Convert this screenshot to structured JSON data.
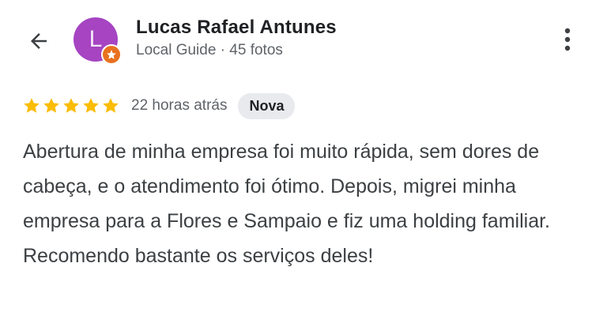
{
  "header": {
    "back_icon": "arrow-back-icon",
    "more_icon": "more-vert-icon"
  },
  "author": {
    "avatar_letter": "L",
    "avatar_color": "#a644c2",
    "badge_color": "#e8711f",
    "name": "Lucas Rafael Antunes",
    "meta": "Local Guide · 45 fotos"
  },
  "review": {
    "rating": 5,
    "max_rating": 5,
    "star_color": "#fbbc04",
    "time_ago": "22 horas atrás",
    "badge": "Nova",
    "text": "Abertura de minha empresa foi muito rápida, sem dores de cabeça, e o atendimento foi ótimo. Depois, migrei minha empresa para a Flores e Sampaio e fiz uma holding familiar. Recomendo bastante os serviços deles!"
  }
}
